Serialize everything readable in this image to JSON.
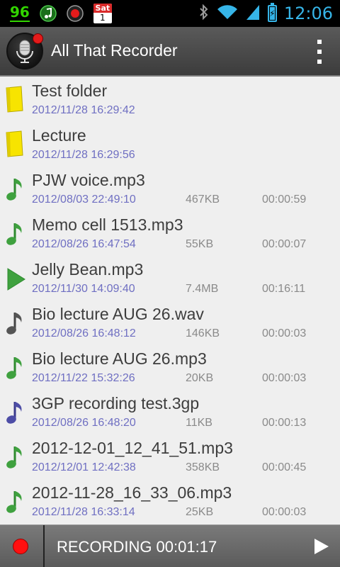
{
  "status_bar": {
    "battery_number": "96",
    "calendar_day_name": "Sat",
    "calendar_day_number": "1",
    "time": "12:06",
    "icons": [
      "notification-number",
      "music-note-icon",
      "record-icon",
      "calendar-icon",
      "bluetooth-icon",
      "wifi-icon",
      "signal-icon",
      "battery-charging-icon"
    ]
  },
  "action_bar": {
    "title": "All That Recorder",
    "menu_icon": "overflow-menu-icon"
  },
  "files": [
    {
      "type": "folder",
      "name": "Test folder",
      "date": "2012/11/28 16:29:42",
      "size": "",
      "duration": ""
    },
    {
      "type": "folder",
      "name": "Lecture",
      "date": "2012/11/28 16:29:56",
      "size": "",
      "duration": ""
    },
    {
      "type": "audio",
      "color": "green",
      "name": "PJW voice.mp3",
      "date": "2012/08/03 22:49:10",
      "size": "467KB",
      "duration": "00:00:59"
    },
    {
      "type": "audio",
      "color": "green",
      "name": "Memo cell 1513.mp3",
      "date": "2012/08/26 16:47:54",
      "size": "55KB",
      "duration": "00:00:07"
    },
    {
      "type": "playing",
      "color": "green",
      "name": "Jelly Bean.mp3",
      "date": "2012/11/30 14:09:40",
      "size": "7.4MB",
      "duration": "00:16:11"
    },
    {
      "type": "audio",
      "color": "gray",
      "name": "Bio lecture AUG 26.wav",
      "date": "2012/08/26 16:48:12",
      "size": "146KB",
      "duration": "00:00:03"
    },
    {
      "type": "audio",
      "color": "green",
      "name": "Bio lecture AUG 26.mp3",
      "date": "2012/11/22 15:32:26",
      "size": "20KB",
      "duration": "00:00:03"
    },
    {
      "type": "audio",
      "color": "purple",
      "name": "3GP recording test.3gp",
      "date": "2012/08/26 16:48:20",
      "size": "11KB",
      "duration": "00:00:13"
    },
    {
      "type": "audio",
      "color": "green",
      "name": "2012-12-01_12_41_51.mp3",
      "date": "2012/12/01 12:42:38",
      "size": "358KB",
      "duration": "00:00:45"
    },
    {
      "type": "audio",
      "color": "green",
      "name": "2012-11-28_16_33_06.mp3",
      "date": "2012/11/28 16:33:14",
      "size": "25KB",
      "duration": "00:00:03"
    }
  ],
  "bottom_bar": {
    "status": "RECORDING 00:01:17",
    "record_icon": "record-dot-icon",
    "play_icon": "play-icon"
  },
  "colors": {
    "accent_blue": "#36b5e8",
    "date_text": "#6f6fc2",
    "note_green": "#3fa13f",
    "note_gray": "#555555",
    "note_purple": "#4d4da6",
    "folder_yellow": "#f7e400",
    "record_red": "#ff1010"
  }
}
